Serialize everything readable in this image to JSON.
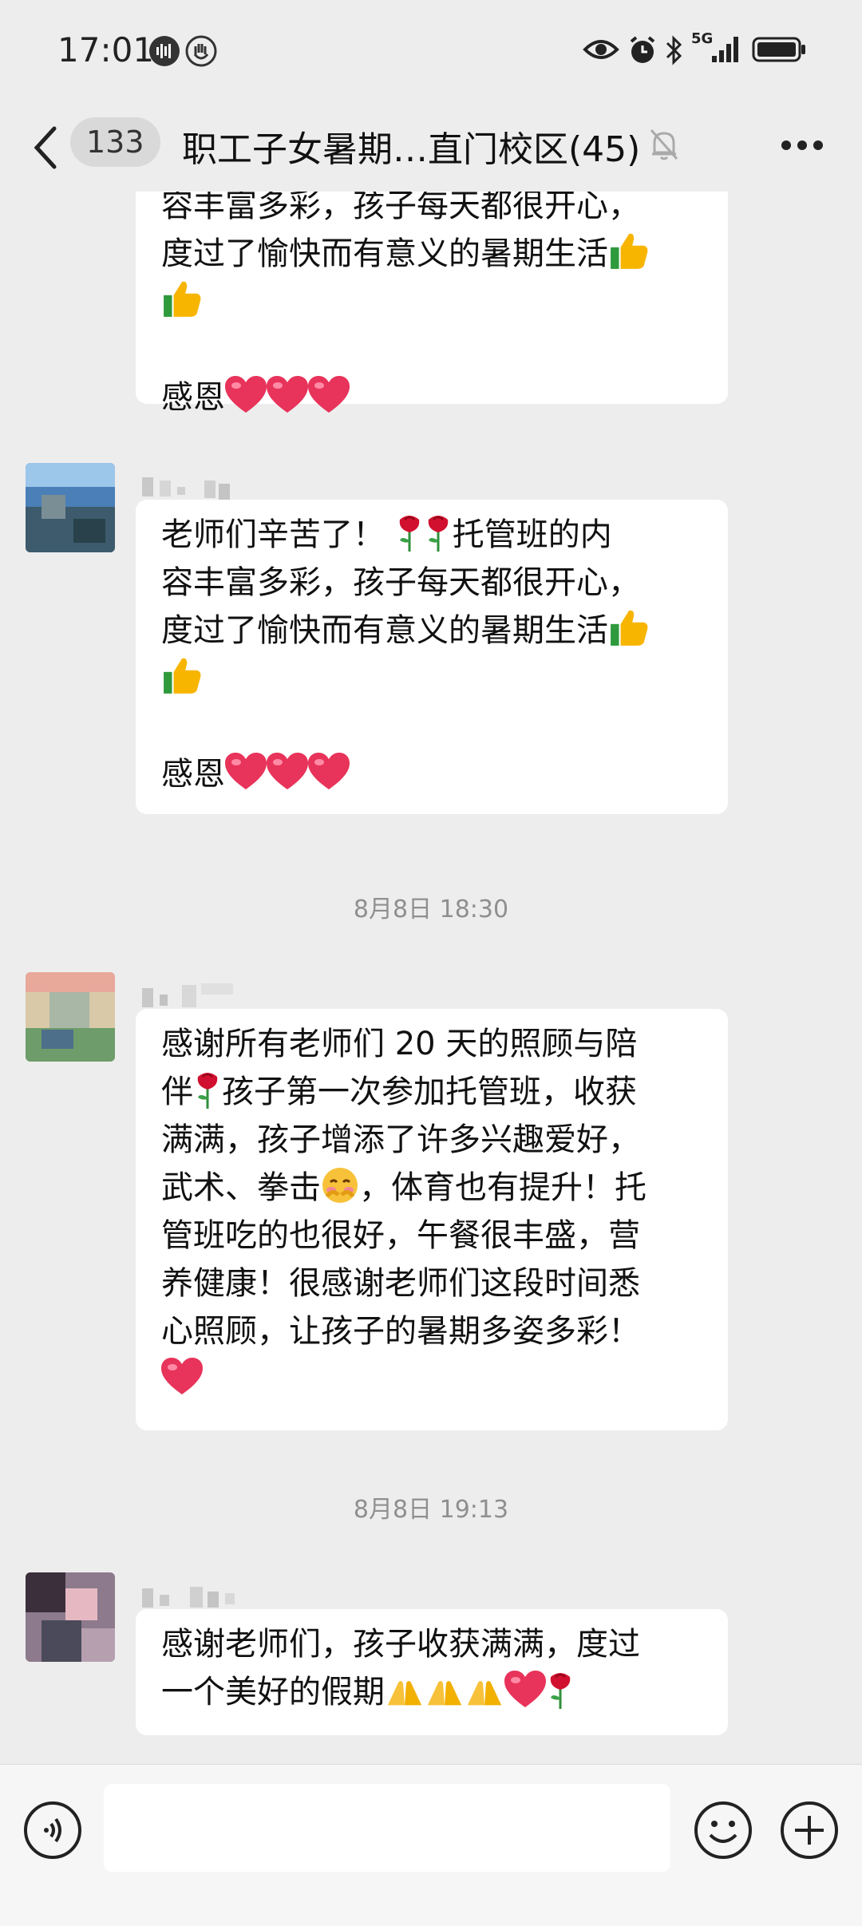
{
  "status_bar": {
    "time": "17:01",
    "network": "5G"
  },
  "header": {
    "badge_count": "133",
    "title": "职工子女暑期…直门校区(45)"
  },
  "messages": {
    "m0": {
      "line1": "容丰富多彩，孩子每天都很开心，",
      "line2": "度过了愉快而有意义的暑期生活",
      "thanks": "感恩"
    },
    "m1": {
      "l1": "老师们辛苦了！",
      "l1b": "托管班的内",
      "l2": "容丰富多彩，孩子每天都很开心，",
      "l3": "度过了愉快而有意义的暑期生活",
      "thanks": "感恩"
    },
    "ts1": "8月8日 18:30",
    "m2": {
      "l1": "感谢所有老师们 20 天的照顾与陪",
      "l2a": "伴",
      "l2b": "孩子第一次参加托管班，收获",
      "l3": "满满，孩子增添了许多兴趣爱好，",
      "l4a": "武术、拳击",
      "l4b": "，体育也有提升！托",
      "l5": "管班吃的也很好，午餐很丰盛，营",
      "l6": "养健康！很感谢老师们这段时间悉",
      "l7": "心照顾，让孩子的暑期多姿多彩！"
    },
    "ts2": "8月8日 19:13",
    "m3": {
      "l1": "感谢老师们，孩子收获满满，度过",
      "l2": "一个美好的假期"
    }
  },
  "icons": [
    "back-icon",
    "mute-icon",
    "more-icon",
    "voice-icon",
    "emoji-icon",
    "plus-icon",
    "thumbs-up-icon",
    "heart-icon",
    "rose-icon",
    "pray-icon"
  ],
  "colors": {
    "background": "#ededed",
    "bubble": "#ffffff",
    "badge": "#d9d9d9",
    "timestamp": "#8f8f8f",
    "heart": "#e8335a",
    "rose": "#c8102e"
  }
}
